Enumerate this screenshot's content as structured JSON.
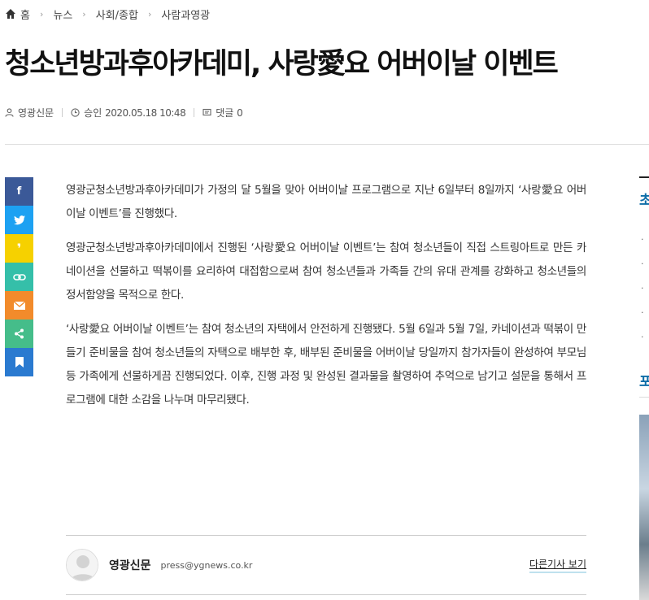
{
  "breadcrumb": {
    "home": "홈",
    "items": [
      "뉴스",
      "사회/종합",
      "사람과영광"
    ]
  },
  "article": {
    "title": "청소년방과후아카데미, 사랑愛요 어버이날 이벤트",
    "author": "영광신문",
    "approved_label": "승인",
    "date": "2020.05.18 10:48",
    "comments_label": "댓글",
    "comments_count": "0",
    "paragraphs": [
      "영광군청소년방과후아카데미가 가정의 달 5월을 맞아 어버이날 프로그램으로 지난 6일부터 8일까지 ‘사랑愛요 어버이날 이벤트’를 진행했다.",
      "영광군청소년방과후아카데미에서 진행된 ‘사랑愛요 어버이날 이벤트’는 참여 청소년들이 직접 스트링아트로 만든 카네이션을 선물하고 떡볶이를 요리하여 대접함으로써 참여 청소년들과 가족들 간의 유대 관계를 강화하고 청소년들의 정서함양을 목적으로 한다.",
      "‘사랑愛요 어버이날 이벤트’는 참여 청소년의 자택에서 안전하게 진행됐다. 5월 6일과 5월 7일, 카네이션과 떡볶이 만들기 준비물을 참여 청소년들의 자택으로 배부한 후, 배부된 준비물을 어버이날 당일까지 참가자들이 완성하여 부모님 등 가족에게 선물하게끔 진행되었다. 이후, 진행 과정 및 완성된 결과물을 촬영하여 추억으로 남기고 설문을 통해서 프로그램에 대한 소감을 나누며 마무리됐다."
    ]
  },
  "share": {
    "buttons": [
      {
        "name": "facebook",
        "glyph": "f",
        "color": "#3b5998"
      },
      {
        "name": "twitter",
        "glyph": "t",
        "color": "#1da1f2"
      },
      {
        "name": "kakaostory",
        "glyph": "❜",
        "color": "#f6d100"
      },
      {
        "name": "link",
        "glyph": "∞",
        "color": "#35bfa9"
      },
      {
        "name": "email",
        "glyph": "✉",
        "color": "#f28b2b"
      },
      {
        "name": "more-share",
        "glyph": "⋖",
        "color": "#45bd8a"
      },
      {
        "name": "bookmark",
        "glyph": "▮",
        "color": "#2a7ad0"
      }
    ]
  },
  "reporter": {
    "name": "영광신문",
    "email": "press@ygnews.co.kr",
    "more_label": "다른기사 보기"
  },
  "sidebar": {
    "heading1": "초",
    "heading2": "포"
  }
}
